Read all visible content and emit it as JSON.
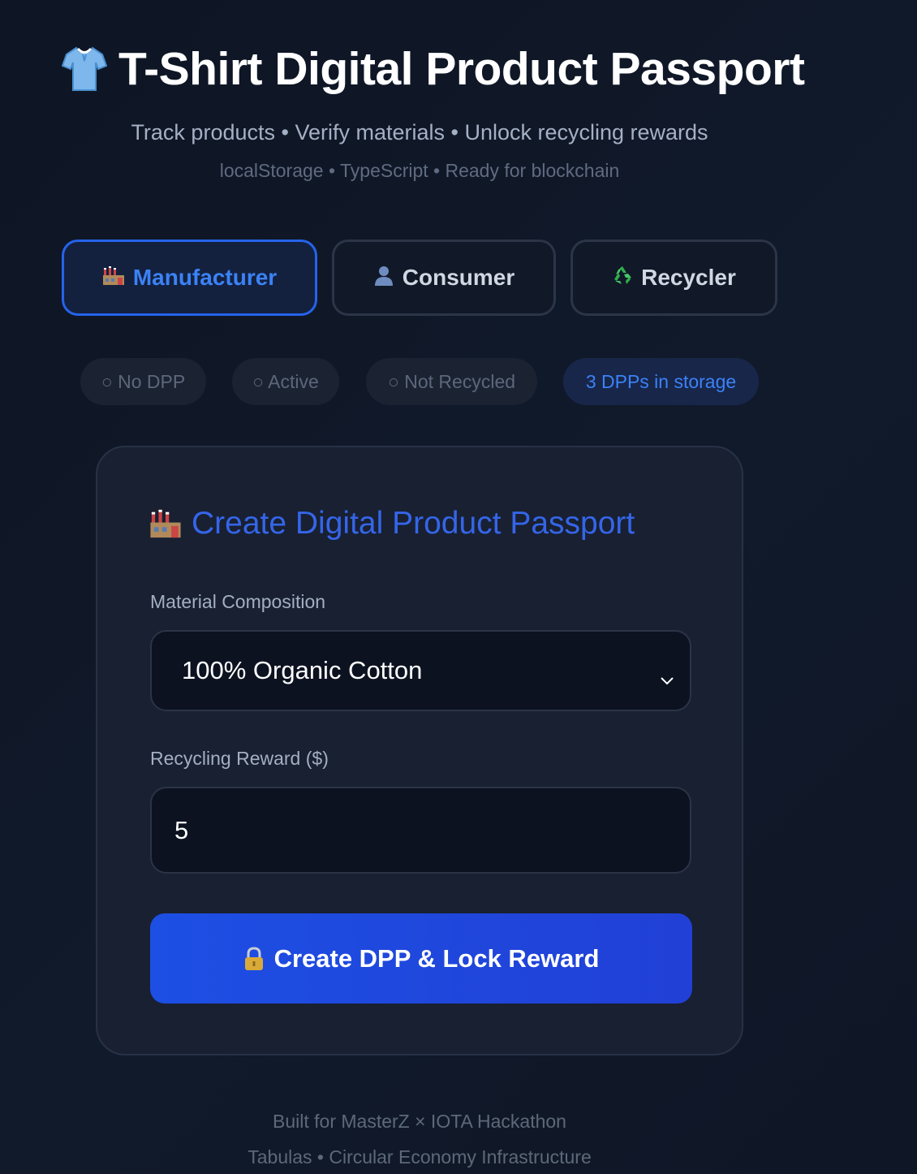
{
  "header": {
    "title": "T-Shirt Digital Product Passport",
    "subtitle": "Track products • Verify materials • Unlock recycling rewards",
    "tagline": "localStorage • TypeScript • Ready for blockchain",
    "icon": "tshirt-icon"
  },
  "tabs": [
    {
      "label": "Manufacturer",
      "icon": "factory-icon",
      "active": true
    },
    {
      "label": "Consumer",
      "icon": "user-icon",
      "active": false
    },
    {
      "label": "Recycler",
      "icon": "recycle-icon",
      "active": false
    }
  ],
  "status_pills": [
    {
      "label": "○ No DPP"
    },
    {
      "label": "○ Active"
    },
    {
      "label": "○ Not Recycled"
    },
    {
      "label": "3 DPPs in storage"
    }
  ],
  "card": {
    "title": "Create Digital Product Passport",
    "icon": "factory-icon",
    "material_label": "Material Composition",
    "material_value": "100% Organic Cotton",
    "reward_label": "Recycling Reward ($)",
    "reward_value": "5",
    "submit_label": "Create DPP & Lock Reward",
    "submit_icon": "lock-icon"
  },
  "footer": {
    "line1": "Built for MasterZ × IOTA Hackathon",
    "line2": "Tabulas • Circular Economy Infrastructure"
  },
  "colors": {
    "accent": "#2563eb",
    "background": "#0f1626",
    "card": "#182032"
  }
}
